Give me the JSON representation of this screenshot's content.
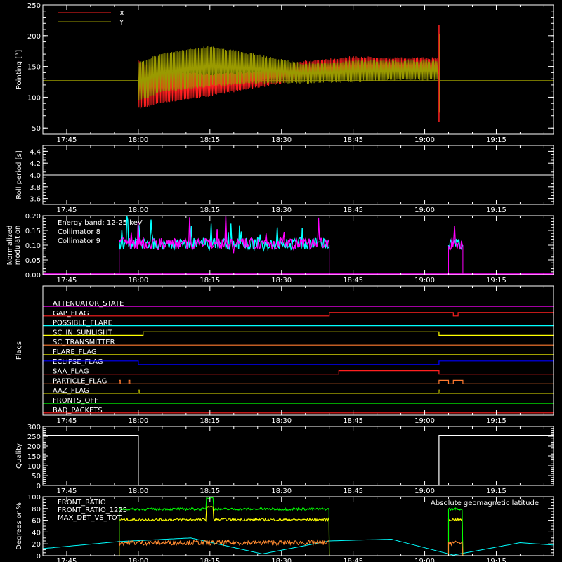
{
  "chart_data": [
    {
      "type": "line",
      "ylabel": "Pointing [°]",
      "xticks": [
        "17:45",
        "18:00",
        "18:15",
        "18:30",
        "18:45",
        "19:00",
        "19:15"
      ],
      "yticks": [
        50,
        100,
        150,
        200,
        250
      ],
      "ylim": [
        40,
        250
      ],
      "x_range": [
        "17:40",
        "19:27"
      ],
      "legend": [
        {
          "name": "X",
          "color": "#ff2020"
        },
        {
          "name": "Y",
          "color": "#9a9a00"
        }
      ],
      "series": [
        {
          "name": "X",
          "color": "#ff2020",
          "x": [
            "18:00",
            "18:05",
            "18:15",
            "18:25",
            "18:35",
            "18:45",
            "18:55",
            "19:03"
          ],
          "upper": [
            160,
            145,
            138,
            143,
            160,
            167,
            165,
            165
          ],
          "lower": [
            80,
            90,
            101,
            115,
            128,
            135,
            137,
            137
          ]
        },
        {
          "name": "Y",
          "color": "#9a9a00",
          "x": [
            "18:00",
            "18:05",
            "18:15",
            "18:25",
            "18:35",
            "18:45",
            "18:55",
            "19:03"
          ],
          "upper": [
            158,
            172,
            184,
            170,
            155,
            160,
            160,
            160
          ],
          "lower": [
            92,
            108,
            117,
            122,
            122,
            124,
            127,
            127
          ]
        }
      ],
      "reference_line": {
        "value": 127,
        "color": "#9a9a00"
      },
      "spike": {
        "x": "19:03",
        "min": 60,
        "max": 218
      }
    },
    {
      "type": "line",
      "ylabel": "Roll period [s]",
      "xticks": [
        "17:45",
        "18:00",
        "18:15",
        "18:30",
        "18:45",
        "19:00",
        "19:15"
      ],
      "yticks": [
        "3.6",
        "3.8",
        "4.0",
        "4.2",
        "4.4"
      ],
      "ylim": [
        3.5,
        4.5
      ],
      "series": [
        {
          "name": "",
          "color": "#ffffff",
          "x": [
            "17:40",
            "19:27"
          ],
          "values": [
            4.0,
            4.0
          ]
        }
      ]
    },
    {
      "type": "bar",
      "ylabel_lines": [
        "Normalized",
        "modulation"
      ],
      "xticks": [
        "17:45",
        "18:00",
        "18:15",
        "18:30",
        "18:45",
        "19:00",
        "19:15"
      ],
      "yticks": [
        "0.00",
        "0.05",
        "0.10",
        "0.15",
        "0.20"
      ],
      "ylim": [
        0,
        0.2
      ],
      "legend_text": "Energy band:  12-25 keV",
      "legend": [
        {
          "name": "Collimator 8",
          "color": "#00ffff"
        },
        {
          "name": "Collimator 9",
          "color": "#ff00ff"
        }
      ],
      "active_intervals": [
        [
          "17:56",
          "18:40"
        ],
        [
          "19:05",
          "19:08"
        ]
      ],
      "typical_value": 0.105,
      "typical_spread": 0.02
    },
    {
      "type": "line",
      "ylabel": "Flags",
      "xticks": [
        "17:45",
        "18:00",
        "18:15",
        "18:30",
        "18:45",
        "19:00",
        "19:15"
      ],
      "flags": [
        {
          "name": "ATTENUATOR_STATE",
          "color": "#ff00ff",
          "steps": []
        },
        {
          "name": "GAP_FLAG",
          "color": "#ff2020",
          "steps": [
            [
              "18:40",
              "19:06"
            ],
            [
              "19:07",
              "19:27"
            ]
          ]
        },
        {
          "name": "POSSIBLE_FLARE",
          "color": "#00ffff",
          "steps": []
        },
        {
          "name": "SC_IN_SUNLIGHT",
          "color": "#ffff00",
          "steps": [
            [
              "18:01",
              "19:03"
            ]
          ]
        },
        {
          "name": "SC_TRANSMITTER",
          "color": "#ff7a30",
          "steps": []
        },
        {
          "name": "FLARE_FLAG",
          "color": "#ffff00",
          "steps": []
        },
        {
          "name": "ECLIPSE_FLAG",
          "color": "#0000ff",
          "steps": [
            [
              "17:40",
              "18:00"
            ],
            [
              "19:03",
              "19:27"
            ]
          ]
        },
        {
          "name": "SAA_FLAG",
          "color": "#ff2020",
          "steps": [
            [
              "18:42",
              "19:03"
            ]
          ]
        },
        {
          "name": "PARTICLE_FLAG",
          "color": "#ff7a30",
          "steps": [
            [
              "17:56",
              "17:56"
            ],
            [
              "17:58",
              "17:58"
            ],
            [
              "19:03",
              "19:05"
            ],
            [
              "19:06",
              "19:08"
            ]
          ]
        },
        {
          "name": "AAZ_FLAG",
          "color": "#9a9a00",
          "steps": [
            [
              "18:00",
              "18:00"
            ],
            [
              "19:03",
              "19:03"
            ]
          ]
        },
        {
          "name": "FRONTS_OFF",
          "color": "#00ff00",
          "steps": []
        },
        {
          "name": "BAD_PACKETS",
          "color": "#ff2020",
          "steps": []
        }
      ]
    },
    {
      "type": "line",
      "ylabel": "Quality",
      "xticks": [
        "17:45",
        "18:00",
        "18:15",
        "18:30",
        "18:45",
        "19:00",
        "19:15"
      ],
      "yticks": [
        0,
        50,
        100,
        150,
        200,
        250,
        300
      ],
      "ylim": [
        0,
        300
      ],
      "series": [
        {
          "name": "",
          "color": "#ffffff",
          "x": [
            "17:40",
            "18:00",
            "18:00",
            "19:03",
            "19:03",
            "19:27"
          ],
          "values": [
            255,
            255,
            0,
            0,
            255,
            255
          ]
        }
      ]
    },
    {
      "type": "line",
      "ylabel": "Degrees or %",
      "xticks": [
        "17:45",
        "18:00",
        "18:15",
        "18:30",
        "18:45",
        "19:00",
        "19:15"
      ],
      "yticks": [
        0,
        20,
        40,
        60,
        80,
        100
      ],
      "ylim": [
        0,
        100
      ],
      "legend": [
        {
          "name": "FRONT_RATIO",
          "color": "#ffff00"
        },
        {
          "name": "FRONT_RATIO_1225",
          "color": "#00ff00"
        },
        {
          "name": "MAX_DET_VS_TOT",
          "color": "#ff8a30"
        }
      ],
      "annotation": {
        "text": "Absolute geomagnetic latitude",
        "color": "#00ffff"
      },
      "series": [
        {
          "name": "FRONT_RATIO",
          "color": "#ffff00",
          "intervals": [
            [
              "17:56",
              "18:40"
            ],
            [
              "19:05",
              "19:08"
            ]
          ],
          "level": 61,
          "spike": {
            "x": "18:15",
            "value": 83
          }
        },
        {
          "name": "FRONT_RATIO_1225",
          "color": "#00ff00",
          "intervals": [
            [
              "17:56",
              "18:40"
            ],
            [
              "19:05",
              "19:08"
            ]
          ],
          "level": 79,
          "spike": {
            "x": "18:15",
            "value": 98
          }
        },
        {
          "name": "MAX_DET_VS_TOT",
          "color": "#ff8a30",
          "intervals": [
            [
              "17:56",
              "18:40"
            ],
            [
              "19:05",
              "19:08"
            ]
          ],
          "level": 22
        },
        {
          "name": "Absolute geomagnetic latitude",
          "color": "#00ffff",
          "x": [
            "17:40",
            "17:56",
            "18:11",
            "18:26",
            "18:40",
            "18:53",
            "19:06",
            "19:20",
            "19:27"
          ],
          "values": [
            12,
            24,
            30,
            3,
            25,
            28,
            1,
            22,
            18
          ]
        }
      ]
    }
  ]
}
